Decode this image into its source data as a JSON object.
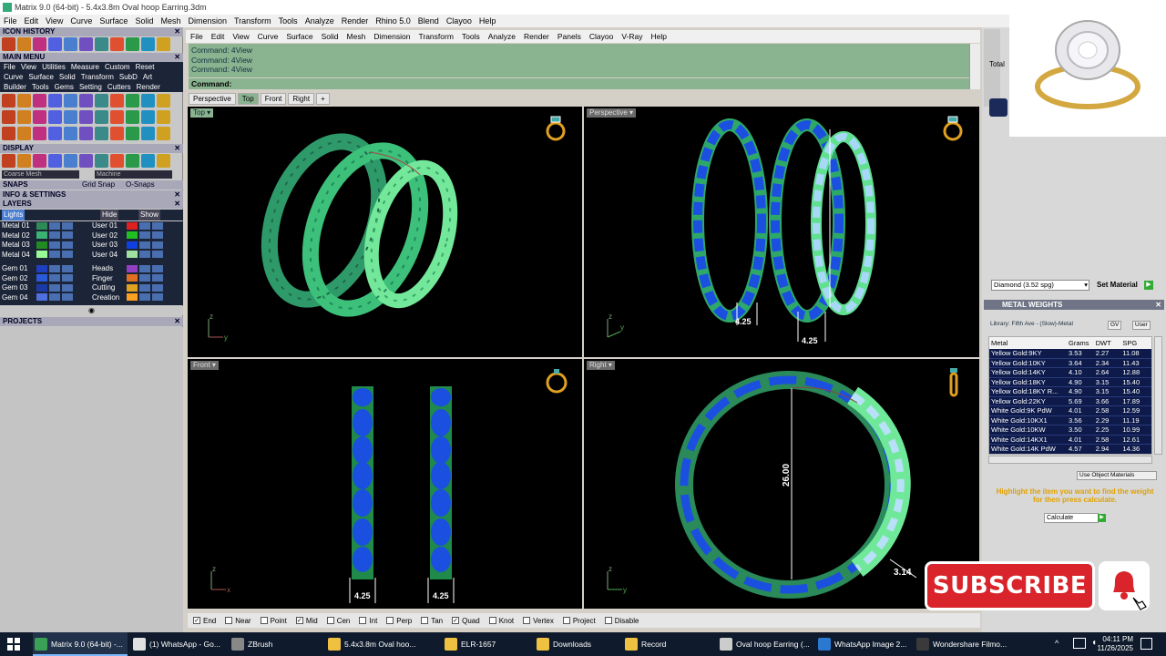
{
  "window": {
    "title": "Matrix 9.0 (64-bit) - 5.4x3.8m Oval hoop Earring.3dm"
  },
  "outer_menu": [
    "File",
    "Edit",
    "View",
    "Curve",
    "Surface",
    "Solid",
    "Mesh",
    "Dimension",
    "Transform",
    "Tools",
    "Analyze",
    "Render",
    "Rhino 5.0",
    "Blend",
    "Clayoo",
    "Help"
  ],
  "left_panel": {
    "icon_history": "ICON HISTORY",
    "main_menu": "MAIN MENU",
    "main_menu_row1": [
      "File",
      "View",
      "Utilities",
      "Measure",
      "Custom",
      "Reset"
    ],
    "main_menu_row2": [
      "Curve",
      "Surface",
      "Solid",
      "Transform",
      "SubD",
      "Art"
    ],
    "main_menu_row3": [
      "Builder",
      "Tools",
      "Gems",
      "Setting",
      "Cutters",
      "Render"
    ],
    "display": "DISPLAY",
    "display_opts": [
      "Coarse Mesh",
      "Machine"
    ],
    "snaps": "SNAPS",
    "snaps_opts": [
      "Grid Snap",
      "O-Snaps"
    ],
    "info_settings": "INFO & SETTINGS",
    "layers": "LAYERS",
    "layers_top": [
      "Lights",
      "Hide",
      "Show"
    ],
    "layers_left": [
      "Metal 01",
      "Metal 02",
      "Metal 03",
      "Metal 04",
      "Gem 01",
      "Gem 02",
      "Gem 03",
      "Gem 04"
    ],
    "layers_right": [
      "User 01",
      "User 02",
      "User 03",
      "User 04",
      "Heads",
      "Finger",
      "Cutting",
      "Creation"
    ],
    "projects": "PROJECTS"
  },
  "colors": {
    "left_swatches": [
      "#2e8b57",
      "#3cb371",
      "#228b22",
      "#98fb98",
      "#1e3fbf",
      "#2a5ad8",
      "#1a3aa8",
      "#5070e0"
    ],
    "right_swatches": [
      "#e02020",
      "#20c020",
      "#1040e0",
      "#a0e0a0",
      "#9040c0",
      "#e07020",
      "#e0a020",
      "#ffa020"
    ]
  },
  "rhino_menu": [
    "File",
    "Edit",
    "View",
    "Curve",
    "Surface",
    "Solid",
    "Mesh",
    "Dimension",
    "Transform",
    "Tools",
    "Analyze",
    "Render",
    "Panels",
    "Clayoo",
    "V-Ray",
    "Help"
  ],
  "command_history": [
    "Command: 4View",
    "Command: 4View",
    "Command: 4View"
  ],
  "command_prompt": "Command:",
  "view_tabs": [
    "Perspective",
    "Top",
    "Front",
    "Right",
    "+"
  ],
  "viewports": {
    "top": "Top",
    "perspective": "Perspective",
    "front": "Front",
    "right": "Right"
  },
  "dimensions": {
    "persp_a": "4.25",
    "persp_b": "4.25",
    "front_a": "4.25",
    "front_b": "4.25",
    "right_height": "26.00",
    "right_width": "3.14"
  },
  "osnaps": [
    {
      "label": "End",
      "checked": true
    },
    {
      "label": "Near",
      "checked": false
    },
    {
      "label": "Point",
      "checked": false
    },
    {
      "label": "Mid",
      "checked": true
    },
    {
      "label": "Cen",
      "checked": false
    },
    {
      "label": "Int",
      "checked": false
    },
    {
      "label": "Perp",
      "checked": false
    },
    {
      "label": "Tan",
      "checked": false
    },
    {
      "label": "Quad",
      "checked": true
    },
    {
      "label": "Knot",
      "checked": false
    },
    {
      "label": "Vertex",
      "checked": false
    },
    {
      "label": "Project",
      "checked": false
    },
    {
      "label": "Disable",
      "checked": false
    }
  ],
  "right_panel": {
    "total_label": "Total",
    "material_select": "Diamond   (3.52 spg)",
    "set_material": "Set Material",
    "metal_weights_title": "METAL WEIGHTS",
    "library": "Library: Fifth Ave - (Slow)-Metal",
    "gv_btn": "GV",
    "user_btn": "User",
    "columns": [
      "Metal",
      "Grams",
      "DWT",
      "SPG"
    ],
    "rows": [
      [
        "Yellow Gold:9KY",
        "3.53",
        "2.27",
        "11.08"
      ],
      [
        "Yellow Gold:10KY",
        "3.64",
        "2.34",
        "11.43"
      ],
      [
        "Yellow Gold:14KY",
        "4.10",
        "2.64",
        "12.88"
      ],
      [
        "Yellow Gold:18KY",
        "4.90",
        "3.15",
        "15.40"
      ],
      [
        "Yellow Gold:18KY R...",
        "4.90",
        "3.15",
        "15.40"
      ],
      [
        "Yellow Gold:22KY",
        "5.69",
        "3.66",
        "17.89"
      ],
      [
        "White Gold:9K PdW",
        "4.01",
        "2.58",
        "12.59"
      ],
      [
        "White Gold:10KX1",
        "3.56",
        "2.29",
        "11.19"
      ],
      [
        "White Gold:10KW",
        "3.50",
        "2.25",
        "10.99"
      ],
      [
        "White Gold:14KX1",
        "4.01",
        "2.58",
        "12.61"
      ],
      [
        "White Gold:14K PdW",
        "4.57",
        "2.94",
        "14.36"
      ]
    ],
    "use_object_materials": "Use Object Materials",
    "hint": "Highlight the item you want to find the weight for then press calculate.",
    "calculate": "Calculate"
  },
  "subscribe": "SUBSCRIBE",
  "taskbar": {
    "items": [
      {
        "label": "Matrix 9.0 (64-bit) -...",
        "color": "#3aa055",
        "active": true
      },
      {
        "label": "(1) WhatsApp - Go...",
        "color": "#e0e0e0",
        "active": false
      },
      {
        "label": "ZBrush",
        "color": "#888888",
        "active": false
      },
      {
        "label": "5.4x3.8m Oval hoo...",
        "color": "#f0c040",
        "active": false
      },
      {
        "label": "ELR-1657",
        "color": "#f0c040",
        "active": false
      },
      {
        "label": "Downloads",
        "color": "#f0c040",
        "active": false
      },
      {
        "label": "Record",
        "color": "#f0c040",
        "active": false
      },
      {
        "label": "Oval hoop Earring (...",
        "color": "#cccccc",
        "active": false
      },
      {
        "label": "WhatsApp Image 2...",
        "color": "#2a78d0",
        "active": false
      },
      {
        "label": "Wondershare Filmo...",
        "color": "#3a3a3a",
        "active": false
      }
    ],
    "time": "04:11 PM",
    "date": "11/26/2025"
  }
}
